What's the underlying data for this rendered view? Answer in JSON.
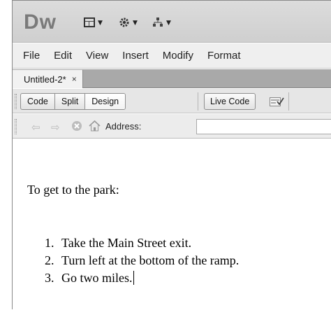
{
  "app": {
    "logo": "Dw"
  },
  "appbar": {
    "buttons": [
      {
        "icon": "layout-icon"
      },
      {
        "icon": "gear-icon"
      },
      {
        "icon": "site-icon"
      }
    ]
  },
  "menu": {
    "items": [
      "File",
      "Edit",
      "View",
      "Insert",
      "Modify",
      "Format"
    ]
  },
  "document_tab": {
    "label": "Untitled-2*",
    "close": "×"
  },
  "view_toolbar": {
    "segments": [
      "Code",
      "Split",
      "Design"
    ],
    "active": "Design",
    "live_code": "Live Code"
  },
  "address_bar": {
    "label": "Address:",
    "value": ""
  },
  "content": {
    "paragraph": "To get to the park:",
    "list": [
      "Take the Main Street exit.",
      "Turn left at the bottom of the ramp.",
      "Go two miles."
    ]
  }
}
